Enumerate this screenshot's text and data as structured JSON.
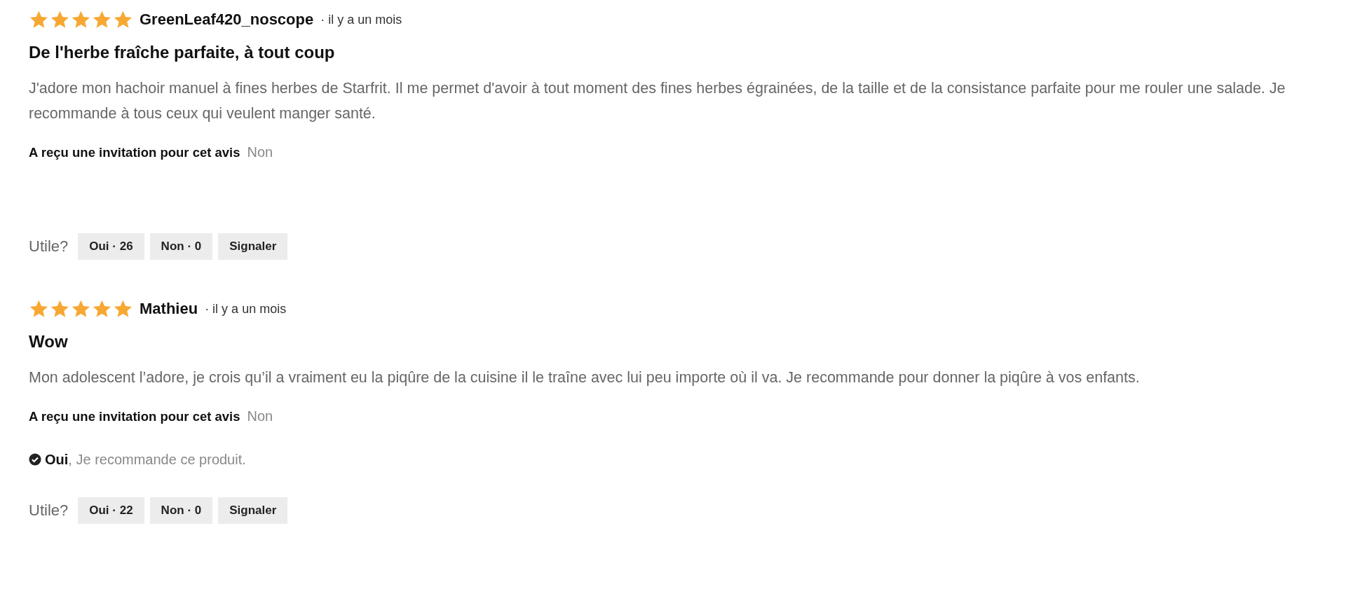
{
  "reviews": [
    {
      "stars": 5,
      "author": "GreenLeaf420_noscope",
      "date": "· il y a un mois",
      "title": "De l'herbe fraîche parfaite, à tout coup",
      "body": "J'adore mon hachoir manuel à fines herbes de Starfrit. Il me permet d'avoir à tout moment des fines herbes égrainées, de la taille et de la consistance parfaite pour me rouler une salade. Je recommande à tous ceux qui veulent manger santé.",
      "invitation_label": "A reçu une invitation pour cet avis",
      "invitation_value": "Non",
      "helpful_label": "Utile?",
      "buttons": [
        "Oui · 26",
        "Non · 0",
        "Signaler"
      ]
    },
    {
      "stars": 5,
      "author": "Mathieu",
      "date": "· il y a un mois",
      "title": "Wow",
      "body": "Mon adolescent l’adore, je crois qu’il a vraiment eu la piqûre de la cuisine il le traîne avec lui peu importe où il va. Je recommande pour donner la piqûre à vos enfants.",
      "invitation_label": "A reçu une invitation pour cet avis",
      "invitation_value": "Non",
      "recommendation": "**Oui**, Je recommande ce produit.",
      "helpful_label": "Utile?",
      "buttons": [
        "Oui · 22",
        "Non · 0",
        "Signaler"
      ]
    }
  ]
}
